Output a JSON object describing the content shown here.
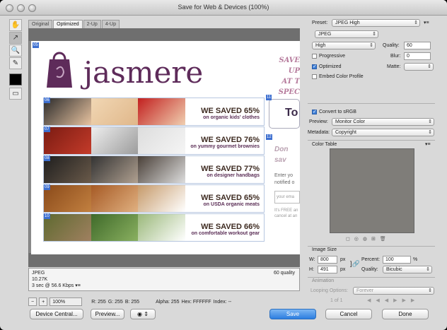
{
  "window": {
    "title": "Save for Web & Devices (100%)"
  },
  "tabs": [
    {
      "label": "Original"
    },
    {
      "label": "Optimized"
    },
    {
      "label": "2-Up"
    },
    {
      "label": "4-Up"
    }
  ],
  "page": {
    "logo_text": "jasmere",
    "save_up": [
      "SAVE UP",
      "AT T",
      "SPEC"
    ],
    "slices": [
      "05",
      "06",
      "07",
      "08",
      "09",
      "10",
      "11",
      "12"
    ],
    "rows": [
      {
        "big": "WE SAVED 65%",
        "small": "on organic kids' clothes"
      },
      {
        "big": "WE SAVED 76%",
        "small": "on yummy gourmet brownies"
      },
      {
        "big": "WE SAVED 77%",
        "small": "on designer handbags"
      },
      {
        "big": "WE SAVED 65%",
        "small": "on USDA organic meats"
      },
      {
        "big": "WE SAVED 66%",
        "small": "on comfortable workout gear"
      }
    ],
    "right_to": "To",
    "right_don": [
      "Don",
      "sav"
    ],
    "right_enter": [
      "Enter yo",
      "notified o"
    ],
    "right_email": "your ema",
    "right_free": [
      "It's FREE an",
      "cancel at an"
    ]
  },
  "status": {
    "format": "JPEG",
    "size": "10.27K",
    "time": "3 sec @ 56.6 Kbps",
    "quality": "60 quality"
  },
  "zoom": {
    "value": "100%",
    "r": "R: 255",
    "g": "G: 255",
    "b": "B: 255",
    "alpha": "Alpha: 255",
    "hex": "Hex: FFFFFF",
    "index": "Index: --"
  },
  "buttons": {
    "device_central": "Device Central...",
    "preview": "Preview...",
    "save": "Save",
    "cancel": "Cancel",
    "done": "Done"
  },
  "panel": {
    "preset_label": "Preset:",
    "preset_value": "JPEG High",
    "format_value": "JPEG",
    "quality_level": "High",
    "quality_label": "Quality:",
    "quality_value": "60",
    "progressive": "Progressive",
    "blur_label": "Blur:",
    "blur_value": "0",
    "optimized": "Optimized",
    "matte_label": "Matte:",
    "embed": "Embed Color Profile",
    "srgb": "Convert to sRGB",
    "preview_label": "Preview:",
    "preview_value": "Monitor Color",
    "metadata_label": "Metadata:",
    "metadata_value": "Copyright",
    "color_table": "Color Table",
    "image_size": "Image Size",
    "w_label": "W:",
    "w_value": "800",
    "h_label": "H:",
    "h_value": "491",
    "px": "px",
    "percent_label": "Percent:",
    "percent_value": "100",
    "pct": "%",
    "quality2_label": "Quality:",
    "quality2_value": "Bicubic",
    "animation": "Animation",
    "looping_label": "Looping Options:",
    "looping_value": "Forever",
    "frame": "1 of 1"
  },
  "colors": {
    "accent": "#5e2b5a",
    "brand_pink": "#b67b9c",
    "save_button": "#2c7ee0"
  }
}
